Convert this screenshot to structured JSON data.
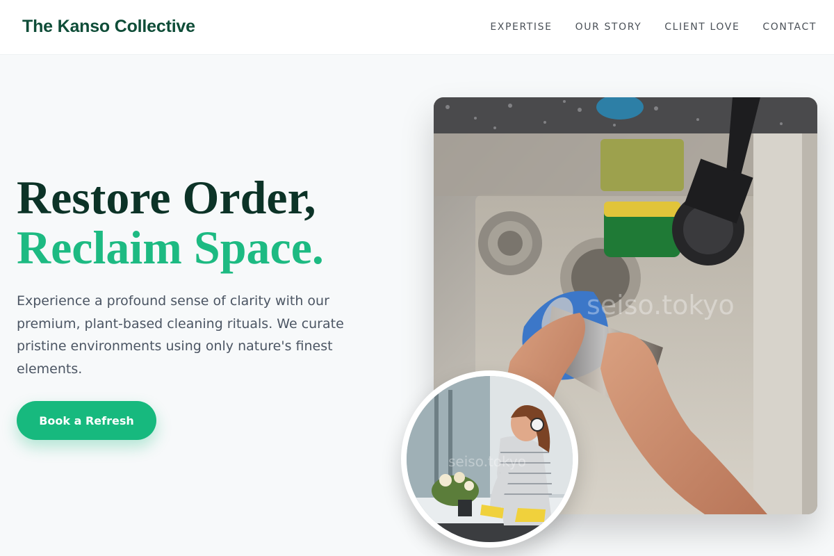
{
  "header": {
    "brand": "The Kanso Collective",
    "nav": [
      "EXPERTISE",
      "OUR STORY",
      "CLIENT LOVE",
      "CONTACT"
    ]
  },
  "hero": {
    "headline_line1": "Restore Order,",
    "headline_line2": "Reclaim Space.",
    "description": "Experience a profound sense of clarity with our premium, plant-based cleaning rituals. We curate pristine environments using only nature's finest elements.",
    "cta_label": "Book a Refresh",
    "main_image_watermark": "seiso.tokyo",
    "inset_image_watermark": "seiso.tokyo"
  },
  "colors": {
    "brand_green": "#0f4d38",
    "accent_green": "#1dba82",
    "headline_dark": "#0c3327",
    "button_green": "#17b97e"
  }
}
